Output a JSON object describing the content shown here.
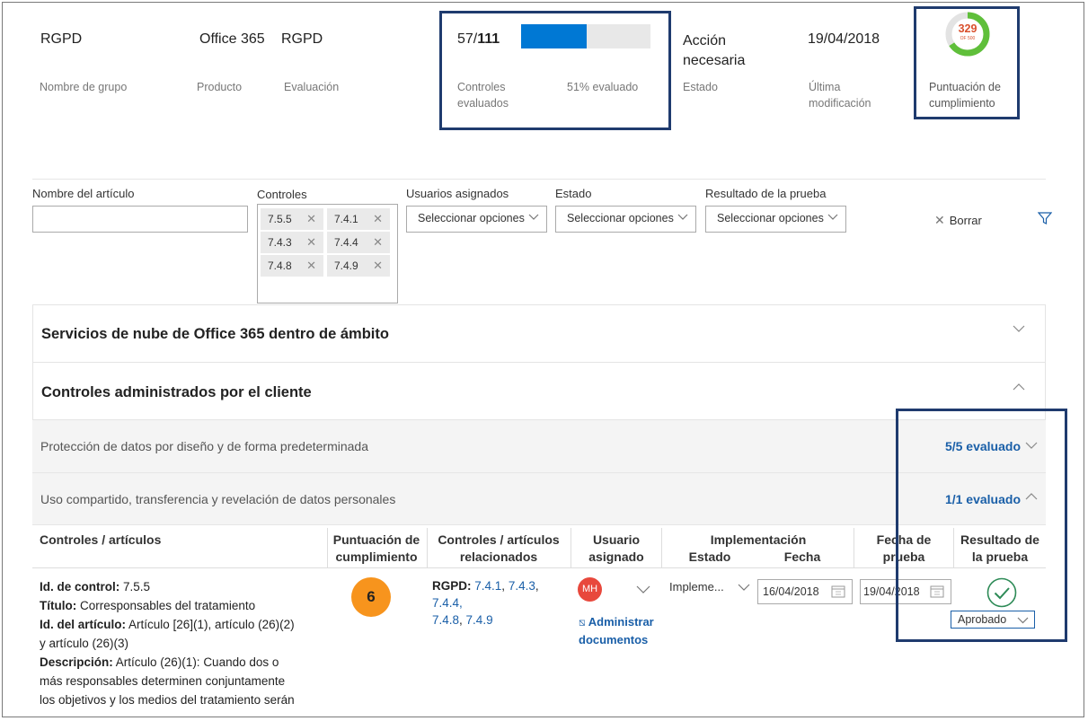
{
  "summary": {
    "group_value": "RGPD",
    "group_label": "Nombre de grupo",
    "product_value": "Office 365",
    "product_label": "Producto",
    "assessment_value": "RGPD",
    "assessment_label": "Evaluación",
    "controls_done": "57/",
    "controls_total": "111",
    "controls_label_1": "Controles",
    "controls_label_2": "evaluados",
    "progress_fraction": 0.51,
    "progress_text": "51% evaluado",
    "status_value_1": "Acción",
    "status_value_2": "necesaria",
    "status_label": "Estado",
    "modified_value": "19/04/2018",
    "modified_label_1": "Última",
    "modified_label_2": "modificación",
    "score_value": "329",
    "score_sub": "OF 500",
    "score_label_1": "Puntuación de",
    "score_label_2": "cumplimiento"
  },
  "filters": {
    "item_name_label": "Nombre del artículo",
    "item_name_value": "",
    "controls_label": "Controles",
    "chips": [
      "7.5.5",
      "7.4.1",
      "7.4.3",
      "7.4.4",
      "7.4.8",
      "7.4.9"
    ],
    "users_label": "Usuarios asignados",
    "users_select": "Seleccionar opciones",
    "status_label": "Estado",
    "status_select": "Seleccionar opciones",
    "result_label": "Resultado de la prueba",
    "result_select": "Seleccionar opciones",
    "clear_label": "Borrar"
  },
  "sections": {
    "cloud_services": "Servicios de nube de Office 365 dentro de ámbito",
    "customer_controls": "Controles administrados por el cliente"
  },
  "subsections": [
    {
      "title": "Protección de datos por diseño y de forma predeterminada",
      "evaluated": "5/5 evaluado"
    },
    {
      "title": "Uso compartido, transferencia y revelación de datos personales",
      "evaluated": "1/1 evaluado"
    }
  ],
  "table": {
    "headers": {
      "controls": "Controles / artículos",
      "score_1": "Puntuación de",
      "score_2": "cumplimiento",
      "related_1": "Controles / artículos",
      "related_2": "relacionados",
      "user_1": "Usuario",
      "user_2": "asignado",
      "impl": "Implementación",
      "impl_status": "Estado",
      "impl_date": "Fecha",
      "test_date_1": "Fecha de",
      "test_date_2": "prueba",
      "result_1": "Resultado de",
      "result_2": "la prueba"
    },
    "row": {
      "control_id_label": "Id. de control:",
      "control_id": " 7.5.5",
      "title_label": "Título:",
      "title": " Corresponsables del tratamiento",
      "article_id_label": "Id. del artículo:",
      "article_id_1": " Artículo [26](1), artículo (26)(2)",
      "article_id_2": "y artículo (26)(3)",
      "description_label": "Descripción:",
      "description_1": " Artículo (26)(1): Cuando dos o",
      "description_2": "más responsables determinen conjuntamente",
      "description_3": "los objetivos y los medios del tratamiento serán",
      "score": "6",
      "related_prefix": "RGPD:",
      "related_links_1": [
        "7.4.1",
        "7.4.3",
        "7.4.4,"
      ],
      "related_links_2": [
        "7.4.8",
        "7.4.9"
      ],
      "user_initials": "MH",
      "manage_docs_1": "Administrar",
      "manage_docs_2": "documentos",
      "impl_status": "Impleme...",
      "impl_date": "16/04/2018",
      "test_date": "19/04/2018",
      "result": "Aprobado"
    }
  },
  "colors": {
    "accent": "#0078d4",
    "highlight_box": "#1f3b6e",
    "score_badge": "#f7941d",
    "avatar": "#e8483c",
    "pass": "#2e8b57"
  }
}
